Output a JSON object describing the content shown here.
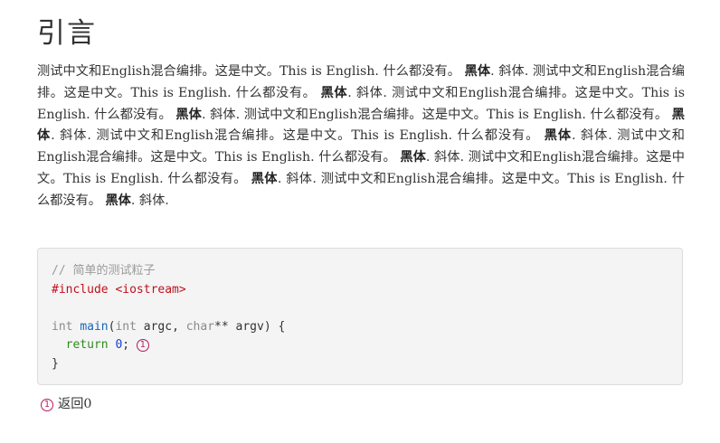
{
  "heading": "引言",
  "paragraph": {
    "seg_intro": "测试中文和English混合编排。这是中文。This is English. 什么都没有。 ",
    "seg_bold": "黑体",
    "seg_mid": ". ",
    "seg_italic": "斜体",
    "seg_end": ". ",
    "repeat_text": "测试中文和English混合编排。这是中文。This is English. 什么都没有。 ",
    "repeat_count_note": ""
  },
  "code": {
    "comment": "// 简单的测试粒子",
    "include": "#include <iostream>",
    "type_int": "int",
    "fn_main": "main",
    "paren_open": "(",
    "type_int2": "int",
    "arg1": " argc, ",
    "type_char": "char",
    "arg2": "** argv) {",
    "kw_return": "return",
    "num_zero": "0",
    "semicolon": ";",
    "close_brace": "}"
  },
  "callout": {
    "marker": "1",
    "text": "返回0"
  }
}
